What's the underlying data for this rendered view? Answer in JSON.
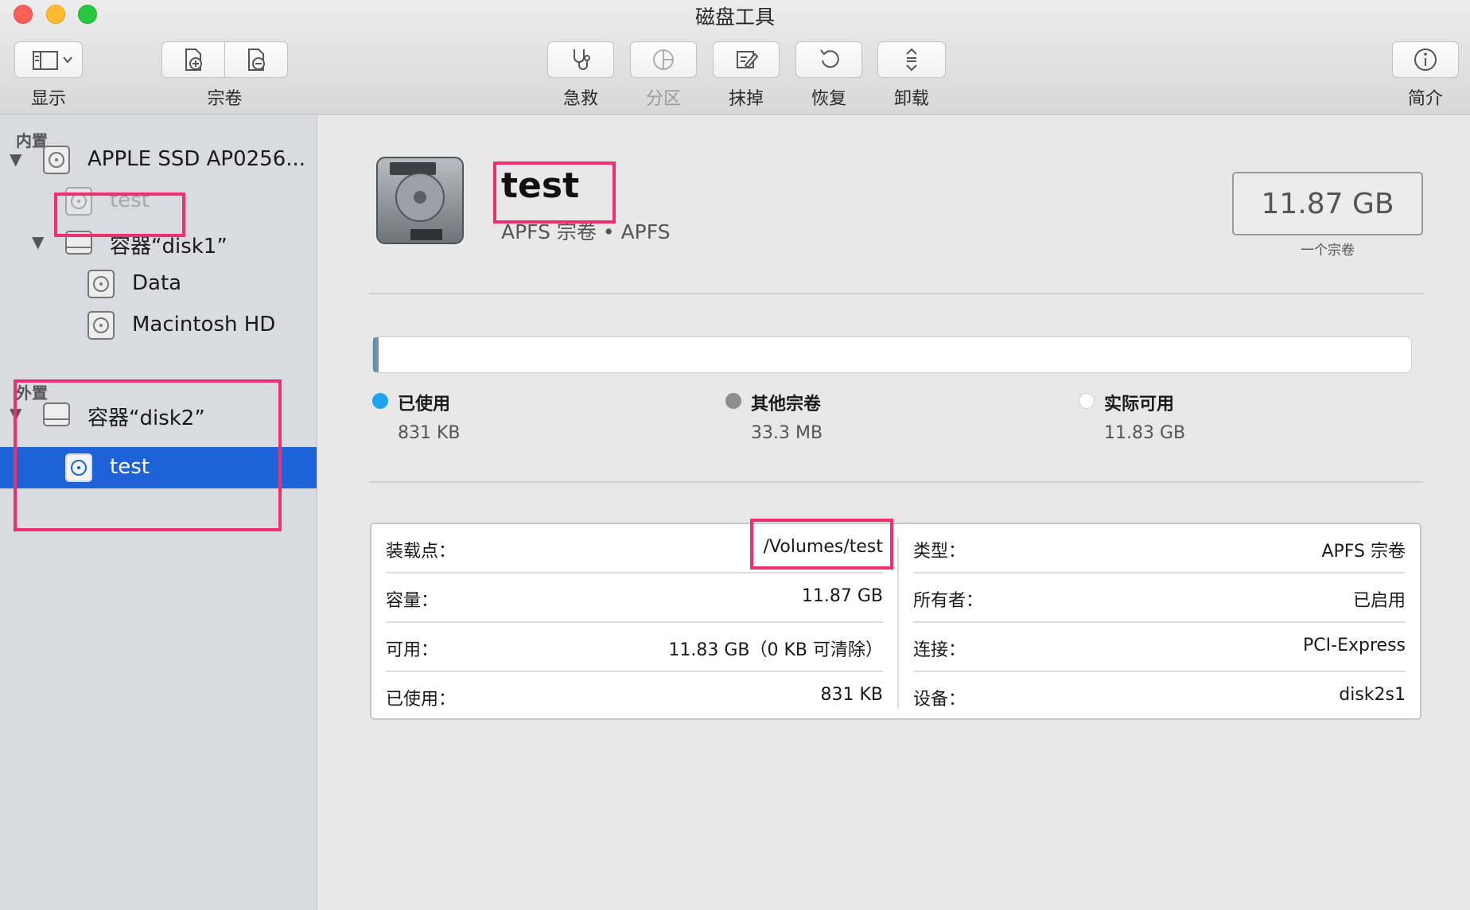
{
  "window": {
    "title": "磁盘工具"
  },
  "toolbar": {
    "view_label": "显示",
    "volume_label": "宗卷",
    "first_aid_label": "急救",
    "partition_label": "分区",
    "erase_label": "抹掉",
    "restore_label": "恢复",
    "unmount_label": "卸载",
    "info_label": "简介"
  },
  "sidebar": {
    "internal_header": "内置",
    "external_header": "外置",
    "items": [
      {
        "label": "APPLE SSD AP0256..."
      },
      {
        "label": "test"
      },
      {
        "label": "容器“disk1”"
      },
      {
        "label": "Data"
      },
      {
        "label": "Macintosh HD"
      },
      {
        "label": "容器“disk2”"
      },
      {
        "label": "test"
      }
    ]
  },
  "volume": {
    "name": "test",
    "subtitle": "APFS 宗卷 • APFS",
    "capacity": "11.87 GB",
    "capacity_caption": "一个宗卷"
  },
  "usage": {
    "used_fraction": 7e-05,
    "other_fraction": 0.0028,
    "used_color": "#1fa3f1",
    "other_color": "#8e8e8e",
    "free_color": "#ffffff",
    "legend": [
      {
        "label": "已使用",
        "value": "831 KB"
      },
      {
        "label": "其他宗卷",
        "value": "33.3 MB"
      },
      {
        "label": "实际可用",
        "value": "11.83 GB"
      }
    ]
  },
  "info": {
    "left": [
      {
        "key": "装载点：",
        "value": "/Volumes/test"
      },
      {
        "key": "容量：",
        "value": "11.87 GB"
      },
      {
        "key": "可用：",
        "value": "11.83 GB（0 KB 可清除）"
      },
      {
        "key": "已使用：",
        "value": "831 KB"
      }
    ],
    "right": [
      {
        "key": "类型：",
        "value": "APFS 宗卷"
      },
      {
        "key": "所有者：",
        "value": "已启用"
      },
      {
        "key": "连接：",
        "value": "PCI-Express"
      },
      {
        "key": "设备：",
        "value": "disk2s1"
      }
    ]
  },
  "highlight_color": "#f0306e"
}
